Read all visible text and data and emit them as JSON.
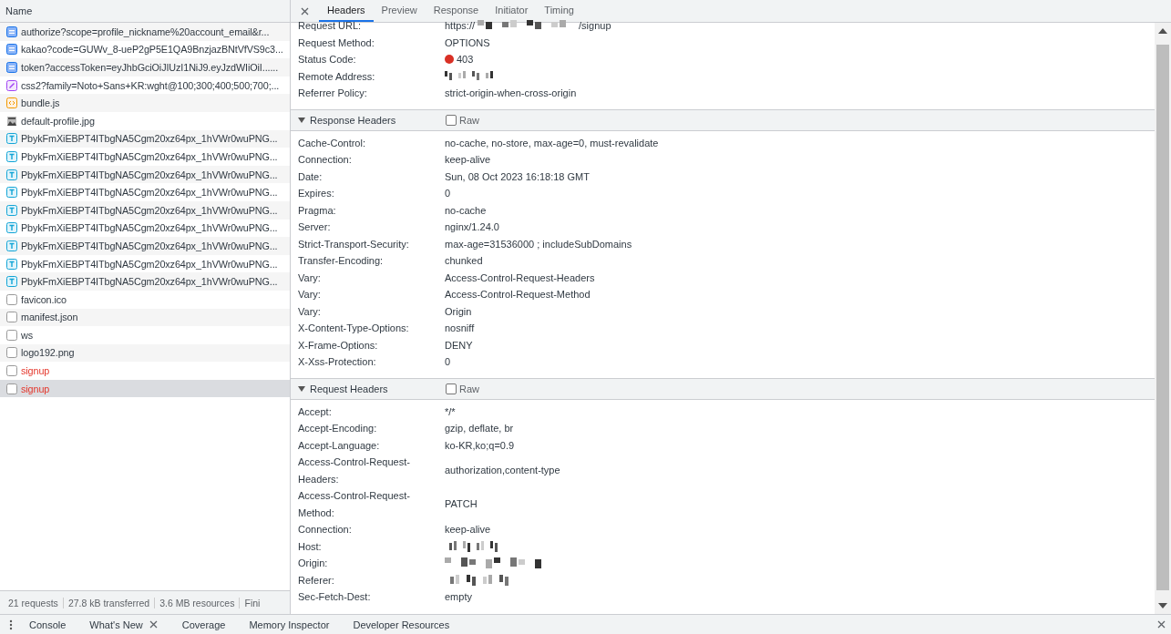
{
  "request_list": {
    "header": "Name",
    "items": [
      {
        "name": "authorize?scope=profile_nickname%20account_email&r...",
        "kind": "document",
        "error": false,
        "selected": false
      },
      {
        "name": "kakao?code=GUWv_8-ueP2gP5E1QA9BnzjazBNtVfVS9c3...",
        "kind": "document",
        "error": false,
        "selected": false
      },
      {
        "name": "token?accessToken=eyJhbGciOiJIUzI1NiJ9.eyJzdWIiOiI......",
        "kind": "document",
        "error": false,
        "selected": false
      },
      {
        "name": "css2?family=Noto+Sans+KR:wght@100;300;400;500;700;...",
        "kind": "stylesheet",
        "error": false,
        "selected": false
      },
      {
        "name": "bundle.js",
        "kind": "script",
        "error": false,
        "selected": false
      },
      {
        "name": "default-profile.jpg",
        "kind": "image",
        "error": false,
        "selected": false
      },
      {
        "name": "PbykFmXiEBPT4ITbgNA5Cgm20xz64px_1hVWr0wuPNG...",
        "kind": "font",
        "error": false,
        "selected": false
      },
      {
        "name": "PbykFmXiEBPT4ITbgNA5Cgm20xz64px_1hVWr0wuPNG...",
        "kind": "font",
        "error": false,
        "selected": false
      },
      {
        "name": "PbykFmXiEBPT4ITbgNA5Cgm20xz64px_1hVWr0wuPNG...",
        "kind": "font",
        "error": false,
        "selected": false
      },
      {
        "name": "PbykFmXiEBPT4ITbgNA5Cgm20xz64px_1hVWr0wuPNG...",
        "kind": "font",
        "error": false,
        "selected": false
      },
      {
        "name": "PbykFmXiEBPT4ITbgNA5Cgm20xz64px_1hVWr0wuPNG...",
        "kind": "font",
        "error": false,
        "selected": false
      },
      {
        "name": "PbykFmXiEBPT4ITbgNA5Cgm20xz64px_1hVWr0wuPNG...",
        "kind": "font",
        "error": false,
        "selected": false
      },
      {
        "name": "PbykFmXiEBPT4ITbgNA5Cgm20xz64px_1hVWr0wuPNG...",
        "kind": "font",
        "error": false,
        "selected": false
      },
      {
        "name": "PbykFmXiEBPT4ITbgNA5Cgm20xz64px_1hVWr0wuPNG...",
        "kind": "font",
        "error": false,
        "selected": false
      },
      {
        "name": "PbykFmXiEBPT4ITbgNA5Cgm20xz64px_1hVWr0wuPNG...",
        "kind": "font",
        "error": false,
        "selected": false
      },
      {
        "name": "favicon.ico",
        "kind": "other",
        "error": false,
        "selected": false
      },
      {
        "name": "manifest.json",
        "kind": "other",
        "error": false,
        "selected": false
      },
      {
        "name": "ws",
        "kind": "other",
        "error": false,
        "selected": false
      },
      {
        "name": "logo192.png",
        "kind": "other",
        "error": false,
        "selected": false
      },
      {
        "name": "signup",
        "kind": "other",
        "error": true,
        "selected": false
      },
      {
        "name": "signup",
        "kind": "other",
        "error": true,
        "selected": true
      }
    ]
  },
  "status_bar": [
    "21 requests",
    "27.8 kB transferred",
    "3.6 MB resources",
    "Fini"
  ],
  "detail_tabs": [
    {
      "label": "Headers",
      "selected": true
    },
    {
      "label": "Preview",
      "selected": false
    },
    {
      "label": "Response",
      "selected": false
    },
    {
      "label": "Initiator",
      "selected": false
    },
    {
      "label": "Timing",
      "selected": false
    }
  ],
  "general": [
    {
      "name": "Request URL:",
      "value": "https://",
      "value_end": "/signup",
      "redacted": true,
      "kind": "plain"
    },
    {
      "name": "Request Method:",
      "value": "OPTIONS",
      "kind": "plain"
    },
    {
      "name": "Status Code:",
      "value": "403",
      "kind": "error"
    },
    {
      "name": "Remote Address:",
      "redacted": true,
      "kind": "plain"
    },
    {
      "name": "Referrer Policy:",
      "value": "strict-origin-when-cross-origin",
      "kind": "plain"
    }
  ],
  "sections": [
    {
      "title": "Response Headers",
      "expanded": true,
      "raw_label": "Raw",
      "raw_checked": false,
      "headers": [
        {
          "name": "Cache-Control:",
          "value": "no-cache, no-store, max-age=0, must-revalidate"
        },
        {
          "name": "Connection:",
          "value": "keep-alive"
        },
        {
          "name": "Date:",
          "value": "Sun, 08 Oct 2023 16:18:18 GMT"
        },
        {
          "name": "Expires:",
          "value": "0"
        },
        {
          "name": "Pragma:",
          "value": "no-cache"
        },
        {
          "name": "Server:",
          "value": "nginx/1.24.0"
        },
        {
          "name": "Strict-Transport-Security:",
          "value": "max-age=31536000 ; includeSubDomains"
        },
        {
          "name": "Transfer-Encoding:",
          "value": "chunked"
        },
        {
          "name": "Vary:",
          "value": "Access-Control-Request-Headers"
        },
        {
          "name": "Vary:",
          "value": "Access-Control-Request-Method"
        },
        {
          "name": "Vary:",
          "value": "Origin"
        },
        {
          "name": "X-Content-Type-Options:",
          "value": "nosniff"
        },
        {
          "name": "X-Frame-Options:",
          "value": "DENY"
        },
        {
          "name": "X-Xss-Protection:",
          "value": "0"
        }
      ]
    },
    {
      "title": "Request Headers",
      "expanded": true,
      "raw_label": "Raw",
      "raw_checked": false,
      "headers": [
        {
          "name": "Accept:",
          "value": "*/*"
        },
        {
          "name": "Accept-Encoding:",
          "value": "gzip, deflate, br"
        },
        {
          "name": "Accept-Language:",
          "value": "ko-KR,ko;q=0.9"
        },
        {
          "name": "Access-Control-Request-Headers:",
          "value": "authorization,content-type"
        },
        {
          "name": "Access-Control-Request-Method:",
          "value": "PATCH"
        },
        {
          "name": "Connection:",
          "value": "keep-alive"
        },
        {
          "name": "Host:",
          "redacted": true
        },
        {
          "name": "Origin:",
          "redacted": true
        },
        {
          "name": "Referer:",
          "redacted": true
        },
        {
          "name": "Sec-Fetch-Dest:",
          "value": "empty"
        }
      ]
    }
  ],
  "drawer_tabs": [
    {
      "label": "Console",
      "closable": false
    },
    {
      "label": "What's New",
      "closable": true
    },
    {
      "label": "Coverage",
      "closable": false
    },
    {
      "label": "Memory Inspector",
      "closable": false
    },
    {
      "label": "Developer Resources",
      "closable": false
    }
  ]
}
